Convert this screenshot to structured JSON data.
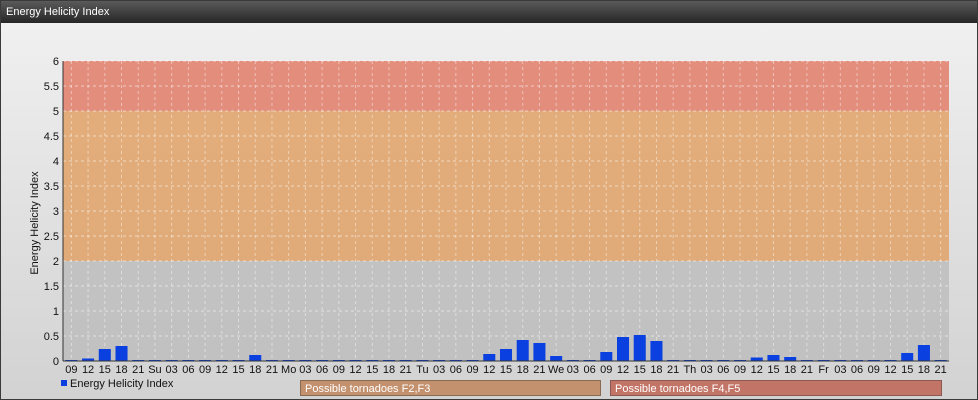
{
  "window": {
    "title": "Energy Helicity Index"
  },
  "colors": {
    "bar": "#0a3fe0",
    "band_low": "#bdbdbd",
    "band_mid": "#e0a266",
    "band_high": "#e27d6a",
    "label_f23": "#c4916e",
    "label_f45": "#c27466"
  },
  "legend": {
    "series_label": "Energy Helicity Index"
  },
  "bands": {
    "f23_label": "Possible tornadoes F2,F3",
    "f45_label": "Possible tornadoes F4,F5"
  },
  "chart_data": {
    "type": "bar",
    "title": "",
    "xlabel": "",
    "ylabel": "Energy Helicity Index",
    "ylim": [
      0,
      6
    ],
    "yticks": [
      "0",
      "0.5",
      "1",
      "1.5",
      "2",
      "2.5",
      "3",
      "3.5",
      "4",
      "4.5",
      "5",
      "5.5",
      "6"
    ],
    "grid": true,
    "legend_position": "bottom-left",
    "background_bands": [
      {
        "from": 0,
        "to": 2,
        "color": "#bdbdbd"
      },
      {
        "from": 2,
        "to": 5,
        "color": "#e0a266"
      },
      {
        "from": 5,
        "to": 6,
        "color": "#e27d6a"
      }
    ],
    "categories": [
      "09",
      "12",
      "15",
      "18",
      "21",
      "Su",
      "03",
      "06",
      "09",
      "12",
      "15",
      "18",
      "21",
      "Mo",
      "03",
      "06",
      "09",
      "12",
      "15",
      "18",
      "21",
      "Tu",
      "03",
      "06",
      "09",
      "12",
      "15",
      "18",
      "21",
      "We",
      "03",
      "06",
      "09",
      "12",
      "15",
      "18",
      "21",
      "Th",
      "03",
      "06",
      "09",
      "12",
      "15",
      "18",
      "21",
      "Fr",
      "03",
      "06",
      "09",
      "12",
      "15",
      "18",
      "21"
    ],
    "series": [
      {
        "name": "Energy Helicity Index",
        "values": [
          0.02,
          0.05,
          0.24,
          0.3,
          0.02,
          0.02,
          0.02,
          0.02,
          0.02,
          0.02,
          0.02,
          0.12,
          0.02,
          0.02,
          0.02,
          0.02,
          0.02,
          0.02,
          0.02,
          0.02,
          0.02,
          0.02,
          0.02,
          0.02,
          0.02,
          0.14,
          0.24,
          0.42,
          0.36,
          0.1,
          0.02,
          0.02,
          0.18,
          0.48,
          0.52,
          0.4,
          0.02,
          0.02,
          0.02,
          0.02,
          0.02,
          0.07,
          0.12,
          0.08,
          0.02,
          0.02,
          0.02,
          0.02,
          0.02,
          0.02,
          0.16,
          0.32,
          0.02
        ]
      }
    ]
  }
}
